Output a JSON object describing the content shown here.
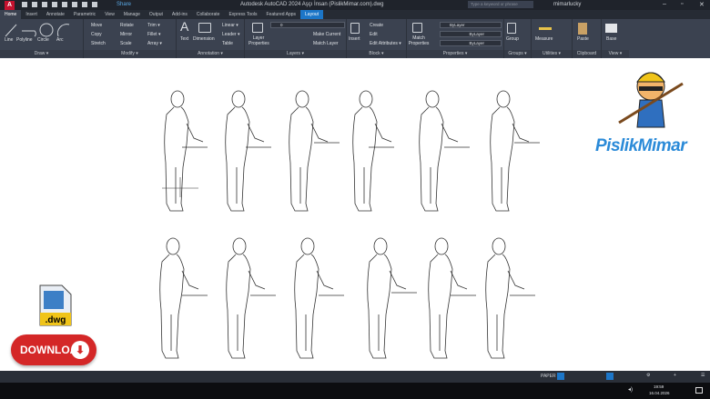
{
  "titlebar": {
    "app_letter": "A",
    "share": "Share",
    "title": "Autodesk AutoCAD 2024   Aşçı İnsan (PislikMimar.com).dwg",
    "search_placeholder": "Type a keyword or phrase",
    "user": "mimarlucky"
  },
  "tabs": [
    "Home",
    "Insert",
    "Annotate",
    "Parametric",
    "View",
    "Manage",
    "Output",
    "Add-ins",
    "Collaborate",
    "Express Tools",
    "Featured Apps",
    "Layout"
  ],
  "ribbon": {
    "draw": {
      "label": "Draw ▾",
      "tools": [
        "Line",
        "Polyline",
        "Circle",
        "Arc"
      ]
    },
    "modify": {
      "label": "Modify ▾",
      "tools": [
        "Move",
        "Rotate",
        "Trim ▾",
        "Copy",
        "Mirror",
        "Fillet ▾",
        "Stretch",
        "Scale",
        "Array ▾"
      ]
    },
    "annotation": {
      "label": "Annotation ▾",
      "tools": [
        "Text",
        "Dimension",
        "Linear ▾",
        "Leader ▾",
        "Table"
      ]
    },
    "layers": {
      "label": "Layers ▾",
      "layer_props": "Layer Properties",
      "current_layer": "0",
      "tools": [
        "Make Current",
        "Match Layer"
      ]
    },
    "block": {
      "label": "Block ▾",
      "insert": "Insert",
      "tools": [
        "Create",
        "Edit",
        "Edit Attributes ▾"
      ]
    },
    "properties": {
      "label": "Properties ▾",
      "match": "Match Properties",
      "color": "ByLayer",
      "linetype": "ByLayer",
      "lineweight": "ByLayer"
    },
    "groups": {
      "label": "Groups ▾",
      "group": "Group"
    },
    "utilities": {
      "label": "Utilities ▾",
      "measure": "Measure"
    },
    "clipboard": {
      "label": "Clipboard",
      "paste": "Paste"
    },
    "view": {
      "label": "View ▾",
      "base": "Base"
    }
  },
  "status": {
    "paper": "PAPER"
  },
  "taskbar": {
    "time": "19:59",
    "date": "16.04.2026"
  },
  "overlay": {
    "download": "DOWNLOAD",
    "file_ext": ".dwg",
    "brand": "PislikMimar"
  },
  "colors": {
    "accent": "#1c76c8",
    "download": "#d42727",
    "brand": "#2a8ad8"
  }
}
